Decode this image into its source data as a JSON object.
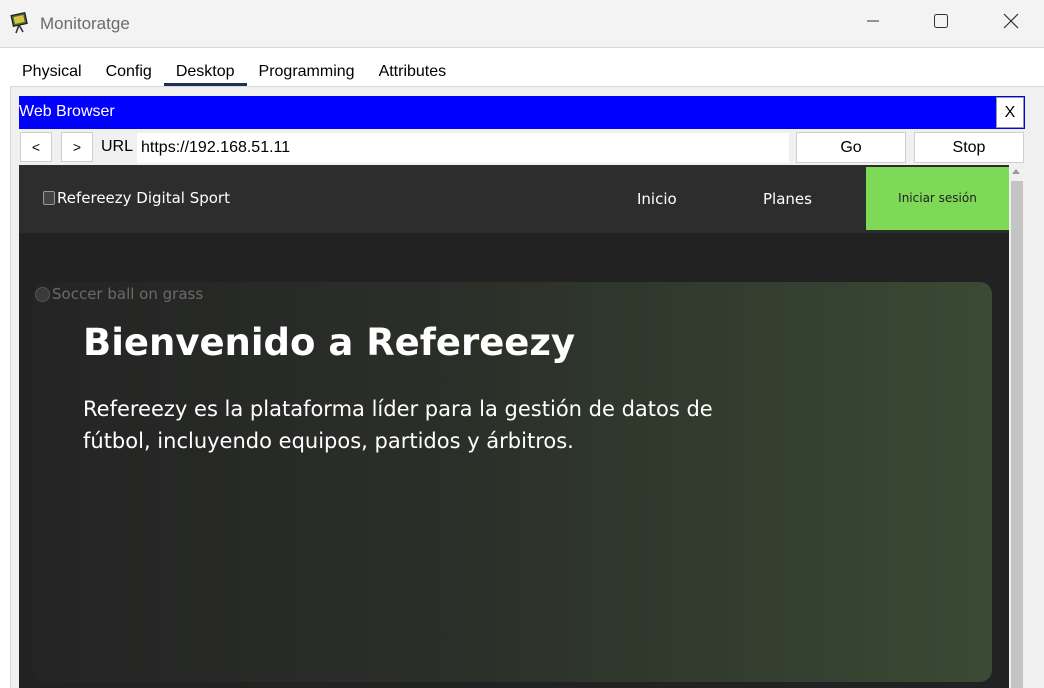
{
  "window": {
    "title": "Monitoratge",
    "minimize_icon": "minimize-icon",
    "maximize_icon": "maximize-icon",
    "close_icon": "close-icon"
  },
  "tabs": [
    {
      "label": "Physical"
    },
    {
      "label": "Config"
    },
    {
      "label": "Desktop",
      "active": true
    },
    {
      "label": "Programming"
    },
    {
      "label": "Attributes"
    }
  ],
  "browser": {
    "title": "Web Browser",
    "close_label": "X",
    "back_label": "<",
    "forward_label": ">",
    "url_label": "URL",
    "url_value": "https://192.168.51.11",
    "go_label": "Go",
    "stop_label": "Stop"
  },
  "site": {
    "logo_alt": "Refereezy Digital Sport",
    "nav": {
      "inicio": "Inicio",
      "planes": "Planes",
      "login": "Iniciar sesión"
    },
    "hero_alt": "Soccer ball on grass",
    "hero_title": "Bienvenido a Refereezy",
    "hero_text": "Refereezy es la plataforma líder para la gestión de datos de fútbol, incluyendo equipos, partidos y árbitros."
  },
  "colors": {
    "browser_bar": "#0000ff",
    "login_button": "#7ed957",
    "page_background": "#222222"
  }
}
